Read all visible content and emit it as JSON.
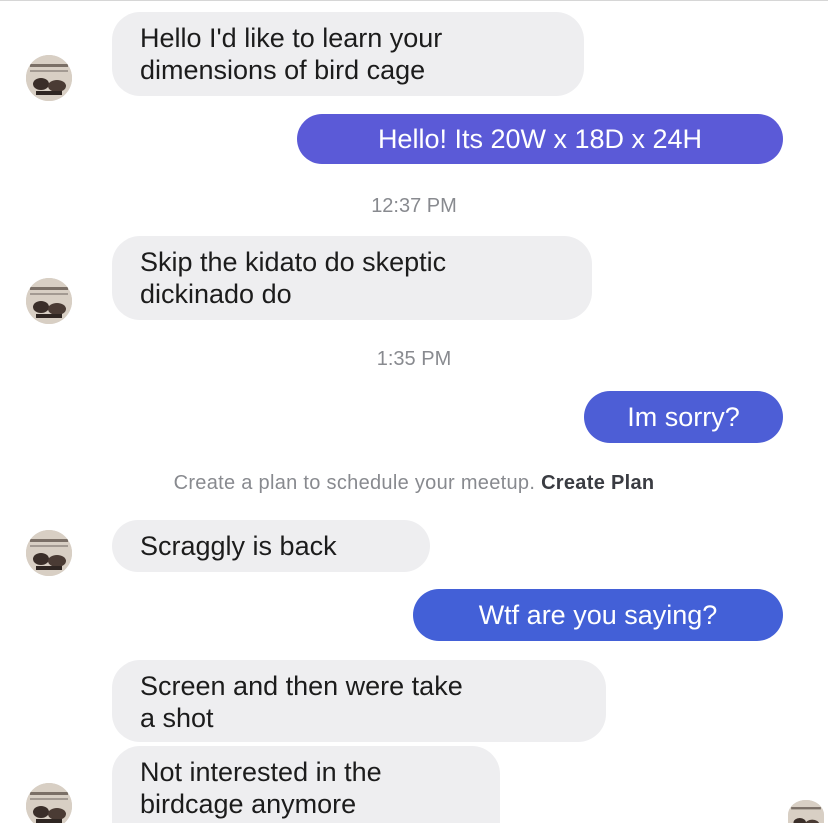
{
  "messages": [
    {
      "id": "m1",
      "line1": "Hello I'd like to learn your",
      "line2": "dimensions of bird cage"
    },
    {
      "id": "m2",
      "text": "Hello! Its 20W x 18D x 24H"
    },
    {
      "id": "t1",
      "text": "12:37 PM"
    },
    {
      "id": "m3",
      "line1": "Skip the kidato do skeptic",
      "line2": "dickinado do"
    },
    {
      "id": "t2",
      "text": "1:35 PM"
    },
    {
      "id": "m4",
      "text": "Im sorry?"
    },
    {
      "id": "m5",
      "text": "Scraggly is back"
    },
    {
      "id": "m6",
      "text": "Wtf are you saying?"
    },
    {
      "id": "m7",
      "line1": "Screen and then were take",
      "line2": "a shot"
    },
    {
      "id": "m8",
      "line1": "Not interested in the",
      "line2": "birdcage anymore"
    }
  ],
  "plan_prompt": {
    "text": "Create a plan to schedule your meetup.",
    "link": "Create Plan"
  },
  "icons": [
    "avatar-icon"
  ],
  "colors": {
    "incoming_bubble": "#eeeef0",
    "outgoing_bubble": "#5b5ad7",
    "timestamp": "#888a8f"
  }
}
